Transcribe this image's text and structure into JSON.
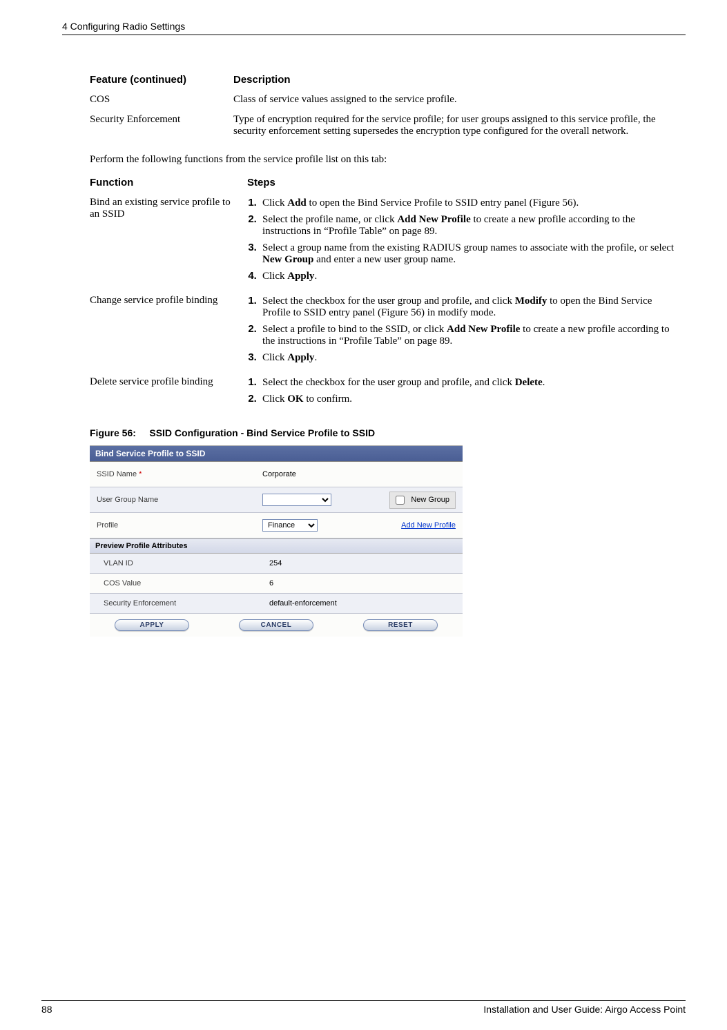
{
  "header": {
    "chapter": "4  Configuring Radio Settings"
  },
  "table1": {
    "col1": "Feature  (continued)",
    "col2": "Description",
    "rows": [
      {
        "feature": "COS",
        "desc": "Class of service values assigned to the service profile."
      },
      {
        "feature": "Security Enforcement",
        "desc": "Type of encryption required for the service profile; for user groups assigned to this service profile, the security enforcement setting supersedes the encryption type configured for the overall network."
      }
    ]
  },
  "paragraph": "Perform the following functions from the service profile list on this tab:",
  "table2": {
    "col1": "Function",
    "col2": "Steps",
    "rows": [
      {
        "function": "Bind an existing service profile to an SSID",
        "steps": [
          {
            "pre": "Click ",
            "b1": "Add",
            "post": " to open the Bind Service Profile to SSID entry panel (Figure 56)."
          },
          {
            "pre": "Select the profile name, or click ",
            "b1": "Add New Profile",
            "post": " to create a new profile according to the instructions in “Profile Table” on page 89."
          },
          {
            "pre": "Select a group name from the existing RADIUS group names to associate with the profile, or select ",
            "b1": "New Group",
            "post": " and enter a new user group name."
          },
          {
            "pre": "Click ",
            "b1": "Apply",
            "post": "."
          }
        ]
      },
      {
        "function": "Change service profile binding",
        "steps": [
          {
            "pre": "Select the checkbox for the user group and profile, and click ",
            "b1": "Modify",
            "post": " to open the Bind Service Profile to SSID entry panel (Figure 56) in modify mode."
          },
          {
            "pre": "Select a profile to bind to the SSID, or click ",
            "b1": "Add New Profile",
            "post": " to create a new profile according to the instructions in “Profile Table” on page 89."
          },
          {
            "pre": "Click ",
            "b1": "Apply",
            "post": "."
          }
        ]
      },
      {
        "function": "Delete service profile binding",
        "steps": [
          {
            "pre": "Select the checkbox for the user group and profile, and click ",
            "b1": "Delete",
            "post": "."
          },
          {
            "pre": "Click ",
            "b1": "OK",
            "post": " to confirm."
          }
        ]
      }
    ]
  },
  "figure": {
    "label": "Figure 56:",
    "title": "SSID Configuration - Bind Service Profile to SSID"
  },
  "panel": {
    "title": "Bind Service Profile to SSID",
    "rows": {
      "ssid_label": "SSID Name",
      "ssid_value": "Corporate",
      "ugroup_label": "User Group Name",
      "ugroup_value": "",
      "new_group": "New Group",
      "profile_label": "Profile",
      "profile_value": "Finance",
      "add_new_profile": "Add New Profile"
    },
    "preview_title": "Preview Profile Attributes",
    "attrs": {
      "vlan_label": "VLAN ID",
      "vlan_value": "254",
      "cos_label": "COS Value",
      "cos_value": "6",
      "sec_label": "Security Enforcement",
      "sec_value": "default-enforcement"
    },
    "buttons": {
      "apply": "APPLY",
      "cancel": "CANCEL",
      "reset": "RESET"
    }
  },
  "footer": {
    "page": "88",
    "title": "Installation and User Guide: Airgo Access Point"
  }
}
